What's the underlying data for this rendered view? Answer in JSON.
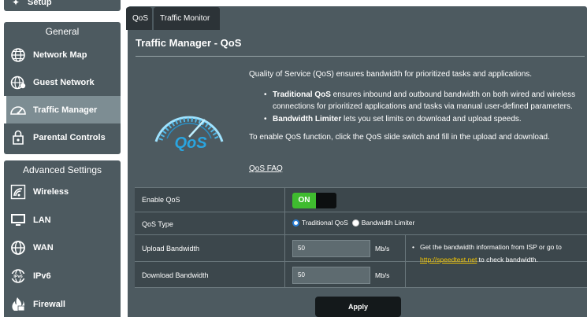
{
  "sidebar": {
    "setup_label": "Setup",
    "general_title": "General",
    "general_items": [
      {
        "label": "Network Map",
        "icon": "globe-icon"
      },
      {
        "label": "Guest Network",
        "icon": "guest-network-icon"
      },
      {
        "label": "Traffic Manager",
        "icon": "speedometer-icon"
      },
      {
        "label": "Parental Controls",
        "icon": "lock-icon"
      }
    ],
    "advanced_title": "Advanced Settings",
    "advanced_items": [
      {
        "label": "Wireless",
        "icon": "wifi-icon"
      },
      {
        "label": "LAN",
        "icon": "monitor-icon"
      },
      {
        "label": "WAN",
        "icon": "globe-icon"
      },
      {
        "label": "IPv6",
        "icon": "ipv6-icon"
      },
      {
        "label": "Firewall",
        "icon": "fire-icon"
      }
    ],
    "active_item": "Traffic Manager"
  },
  "tabs": [
    {
      "label": "QoS",
      "active": true
    },
    {
      "label": "Traffic Monitor",
      "active": false
    }
  ],
  "page": {
    "title": "Traffic Manager - QoS",
    "intro": "Quality of Service (QoS) ensures bandwidth for prioritized tasks and applications.",
    "bullet1_bold": "Traditional QoS",
    "bullet1_text": " ensures inbound and outbound bandwidth on both wired and wireless connections for prioritized applications and tasks via manual user-defined parameters.",
    "bullet2_bold": "Bandwidth Limiter",
    "bullet2_text": " lets you set limits on download and upload speeds.",
    "enable_note": "To enable QoS function, click the QoS slide switch and fill in the upload and download.",
    "faq_link": "QoS FAQ",
    "logo_text": "QoS"
  },
  "settings": {
    "enable_qos_label": "Enable QoS",
    "toggle_on_text": "ON",
    "qos_type_label": "QoS Type",
    "qos_type_options": [
      "Traditional QoS",
      "Bandwidth Limiter"
    ],
    "qos_type_selected": "Traditional QoS",
    "upload_label": "Upload Bandwidth",
    "upload_value": "50",
    "upload_unit": "Mb/s",
    "download_label": "Download Bandwidth",
    "download_value": "50",
    "download_unit": "Mb/s",
    "note_text_before": "Get the bandwidth information from ISP or go to ",
    "note_link": "http://speedtest.net",
    "note_text_after": " to check bandwidth.",
    "apply_label": "Apply"
  },
  "colors": {
    "panel": "#4d5a60",
    "active_nav": "#7d8d93",
    "toggle_on": "#3fbc2f",
    "link_yellow": "#f3c500",
    "radio_checked": "#2a7fd6"
  }
}
